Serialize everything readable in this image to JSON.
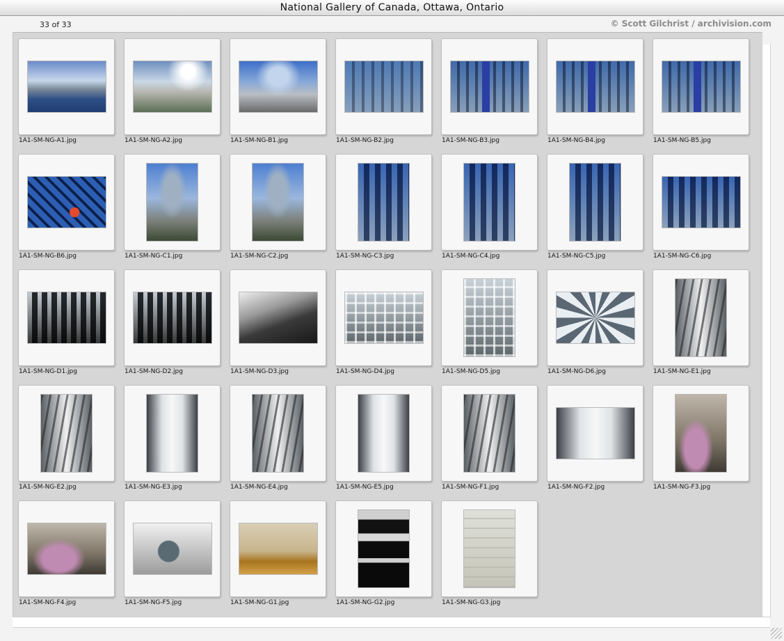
{
  "window": {
    "title": "National Gallery of Canada, Ottawa, Ontario"
  },
  "header": {
    "counter": "33 of 33",
    "credit": "© Scott Gilchrist / archivision.com"
  },
  "thumbnails": [
    {
      "caption": "1A1-SM-NG-A1.jpg",
      "orientation": "landscape",
      "look": "bridge"
    },
    {
      "caption": "1A1-SM-NG-A2.jpg",
      "orientation": "landscape",
      "look": "sky-dramatic"
    },
    {
      "caption": "1A1-SM-NG-B1.jpg",
      "orientation": "landscape",
      "look": "glass-day"
    },
    {
      "caption": "1A1-SM-NG-B2.jpg",
      "orientation": "landscape",
      "look": "facade"
    },
    {
      "caption": "1A1-SM-NG-B3.jpg",
      "orientation": "landscape",
      "look": "banner-facade"
    },
    {
      "caption": "1A1-SM-NG-B4.jpg",
      "orientation": "landscape",
      "look": "banner-facade"
    },
    {
      "caption": "1A1-SM-NG-B5.jpg",
      "orientation": "landscape",
      "look": "banner-facade"
    },
    {
      "caption": "1A1-SM-NG-B6.jpg",
      "orientation": "landscape",
      "look": "blue-interior"
    },
    {
      "caption": "1A1-SM-NG-C1.jpg",
      "orientation": "portrait",
      "look": "tower-portrait"
    },
    {
      "caption": "1A1-SM-NG-C2.jpg",
      "orientation": "portrait",
      "look": "tower-portrait"
    },
    {
      "caption": "1A1-SM-NG-C3.jpg",
      "orientation": "portrait",
      "look": "columns-blue"
    },
    {
      "caption": "1A1-SM-NG-C4.jpg",
      "orientation": "portrait",
      "look": "columns-blue"
    },
    {
      "caption": "1A1-SM-NG-C5.jpg",
      "orientation": "portrait",
      "look": "columns-blue"
    },
    {
      "caption": "1A1-SM-NG-C6.jpg",
      "orientation": "landscape",
      "look": "columns-blue"
    },
    {
      "caption": "1A1-SM-NG-D1.jpg",
      "orientation": "landscape",
      "look": "hall-dark"
    },
    {
      "caption": "1A1-SM-NG-D2.jpg",
      "orientation": "landscape",
      "look": "hall-dark"
    },
    {
      "caption": "1A1-SM-NG-D3.jpg",
      "orientation": "landscape",
      "look": "stair-dark"
    },
    {
      "caption": "1A1-SM-NG-D4.jpg",
      "orientation": "landscape",
      "look": "atrium-grid"
    },
    {
      "caption": "1A1-SM-NG-D5.jpg",
      "orientation": "portrait",
      "look": "atrium-grid"
    },
    {
      "caption": "1A1-SM-NG-D6.jpg",
      "orientation": "landscape",
      "look": "dome-ceiling"
    },
    {
      "caption": "1A1-SM-NG-E1.jpg",
      "orientation": "portrait",
      "look": "corridor-lines"
    },
    {
      "caption": "1A1-SM-NG-E2.jpg",
      "orientation": "portrait",
      "look": "corridor-lines"
    },
    {
      "caption": "1A1-SM-NG-E3.jpg",
      "orientation": "portrait",
      "look": "corridor"
    },
    {
      "caption": "1A1-SM-NG-E4.jpg",
      "orientation": "portrait",
      "look": "corridor-lines"
    },
    {
      "caption": "1A1-SM-NG-E5.jpg",
      "orientation": "portrait",
      "look": "corridor"
    },
    {
      "caption": "1A1-SM-NG-F1.jpg",
      "orientation": "portrait",
      "look": "corridor-lines"
    },
    {
      "caption": "1A1-SM-NG-F2.jpg",
      "orientation": "landscape",
      "look": "corridor"
    },
    {
      "caption": "1A1-SM-NG-F3.jpg",
      "orientation": "portrait",
      "look": "courtyard"
    },
    {
      "caption": "1A1-SM-NG-F4.jpg",
      "orientation": "landscape",
      "look": "courtyard"
    },
    {
      "caption": "1A1-SM-NG-F5.jpg",
      "orientation": "landscape",
      "look": "pool"
    },
    {
      "caption": "1A1-SM-NG-G1.jpg",
      "orientation": "landscape",
      "look": "gallery-room"
    },
    {
      "caption": "1A1-SM-NG-G2.jpg",
      "orientation": "portrait",
      "look": "skylight-dark"
    },
    {
      "caption": "1A1-SM-NG-G3.jpg",
      "orientation": "portrait",
      "look": "hall-white"
    }
  ]
}
